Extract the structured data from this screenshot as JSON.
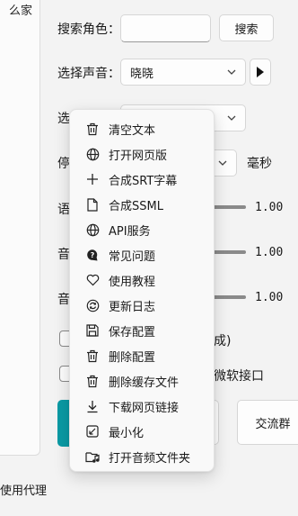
{
  "left_panel": {
    "title_fragment": "么家"
  },
  "proxy_label": "使用代理",
  "search": {
    "label": "搜索角色：",
    "input_value": "",
    "button_label": "搜索"
  },
  "voice": {
    "label": "选择声音：",
    "selected": "晓晓",
    "play_icon": "play-icon"
  },
  "row3": {
    "label_fragment": "选"
  },
  "pause": {
    "label_fragment": "停",
    "unit": "毫秒"
  },
  "sliders": [
    {
      "label_fragment": "语",
      "value": "1.00"
    },
    {
      "label_fragment": "音",
      "value": "1.00"
    },
    {
      "label_fragment": "音",
      "value": "1.00"
    }
  ],
  "checkboxes": [
    {
      "label_fragment": "成)",
      "checked": false
    },
    {
      "label_fragment": "微软接口",
      "checked": false
    }
  ],
  "bottom": {
    "group_button": "交流群",
    "accent_color": "#0a9aa4"
  },
  "menu": {
    "items": [
      {
        "label": "清空文本",
        "icon": "trash-icon"
      },
      {
        "label": "打开网页版",
        "icon": "globe-icon"
      },
      {
        "label": "合成SRT字幕",
        "icon": "plus-icon"
      },
      {
        "label": "合成SSML",
        "icon": "document-icon"
      },
      {
        "label": "API服务",
        "icon": "globe-icon"
      },
      {
        "label": "常见问题",
        "icon": "chat-question-icon"
      },
      {
        "label": "使用教程",
        "icon": "heart-icon"
      },
      {
        "label": "更新日志",
        "icon": "refresh-icon"
      },
      {
        "label": "保存配置",
        "icon": "save-icon"
      },
      {
        "label": "删除配置",
        "icon": "trash-icon"
      },
      {
        "label": "删除缓存文件",
        "icon": "trash-icon"
      },
      {
        "label": "下载网页链接",
        "icon": "download-icon"
      },
      {
        "label": "最小化",
        "icon": "minimize-icon"
      },
      {
        "label": "打开音频文件夹",
        "icon": "music-folder-icon"
      }
    ]
  }
}
